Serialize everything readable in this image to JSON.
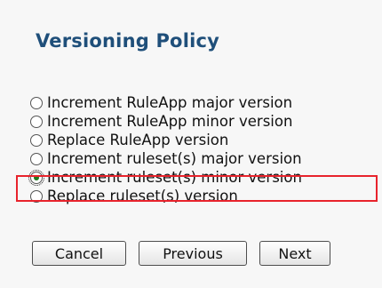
{
  "dialog": {
    "title": "Versioning Policy"
  },
  "options": [
    {
      "label": "Increment RuleApp major version",
      "checked": false
    },
    {
      "label": "Increment RuleApp minor version",
      "checked": false
    },
    {
      "label": "Replace RuleApp version",
      "checked": false
    },
    {
      "label": "Increment ruleset(s) major version",
      "checked": false
    },
    {
      "label": "Increment ruleset(s) minor version",
      "checked": true
    },
    {
      "label": "Replace ruleset(s) version",
      "checked": false
    }
  ],
  "buttons": {
    "cancel": "Cancel",
    "previous": "Previous",
    "next": "Next"
  },
  "highlight_color": "#e8232c"
}
